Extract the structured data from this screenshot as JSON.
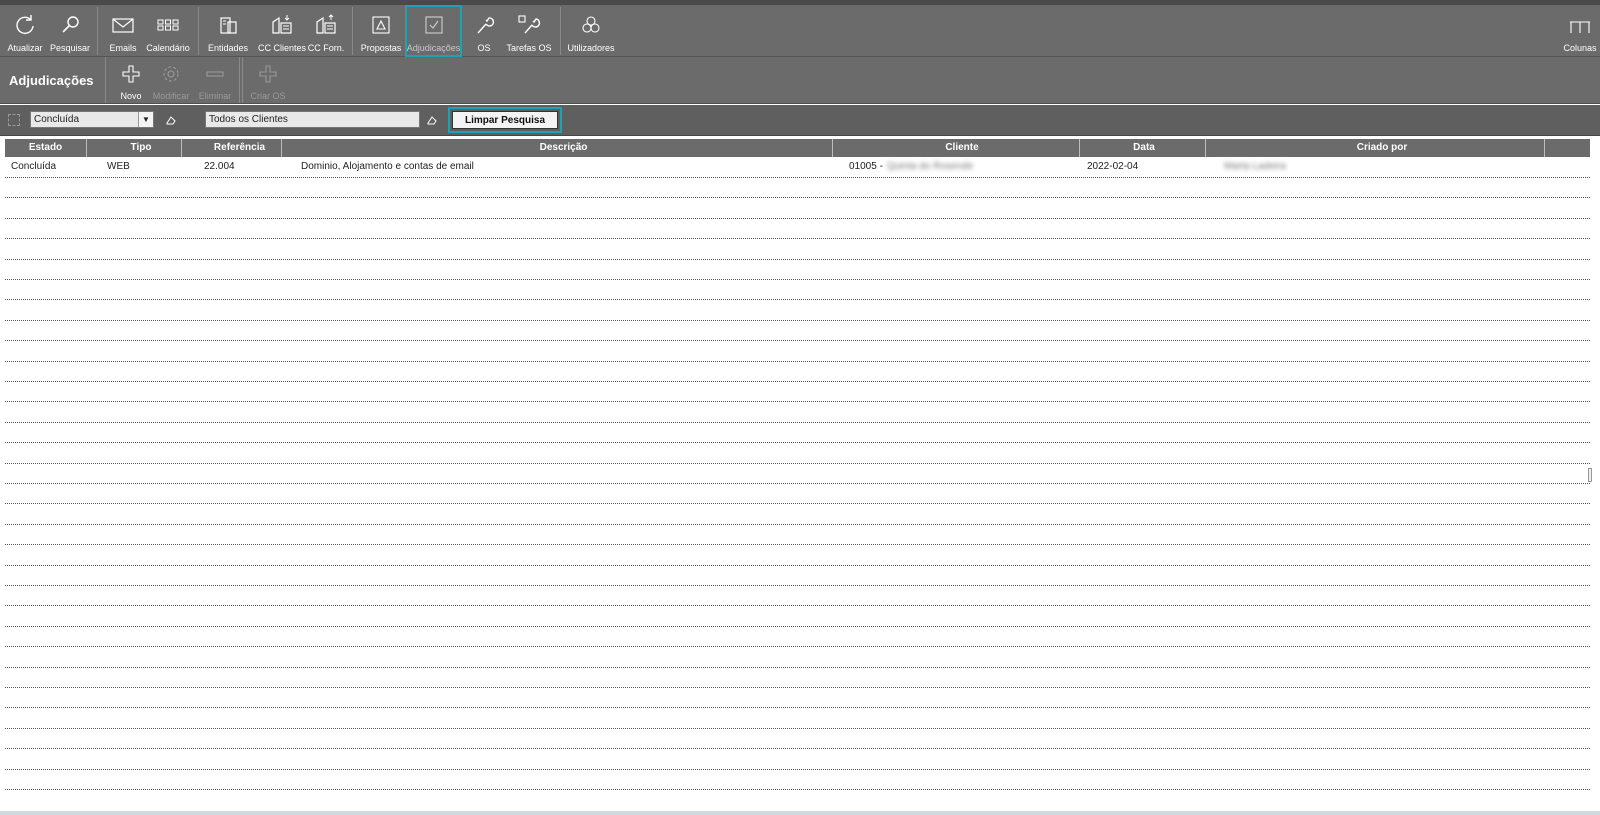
{
  "toolbar": {
    "items": [
      {
        "label": "Atualizar",
        "icon": "refresh-icon"
      },
      {
        "label": "Pesquisar",
        "icon": "search-icon"
      },
      {
        "label": "Emails",
        "icon": "mail-icon"
      },
      {
        "label": "Calendário",
        "icon": "calendar-icon"
      },
      {
        "label": "Entidades",
        "icon": "entities-icon"
      },
      {
        "label": "CC Clientes",
        "icon": "client-accounts-icon"
      },
      {
        "label": "CC Forn.",
        "icon": "supplier-accounts-icon"
      },
      {
        "label": "Propostas",
        "icon": "proposals-icon"
      },
      {
        "label": "Adjudicações",
        "icon": "check-icon"
      },
      {
        "label": "OS",
        "icon": "wrench-icon"
      },
      {
        "label": "Tarefas OS",
        "icon": "tasks-wrench-icon"
      },
      {
        "label": "Utilizadores",
        "icon": "users-icon"
      },
      {
        "label": "Colunas",
        "icon": "columns-icon"
      }
    ]
  },
  "section": {
    "title": "Adjudicações",
    "actions": [
      {
        "label": "Novo",
        "icon": "plus-icon"
      },
      {
        "label": "Modificar",
        "icon": "gear-icon"
      },
      {
        "label": "Eliminar",
        "icon": "minus-icon"
      },
      {
        "label": "Criar OS",
        "icon": "plus-icon"
      }
    ]
  },
  "filter": {
    "status_value": "Concluída",
    "client_value": "Todos os Clientes",
    "clear_label": "Limpar Pesquisa"
  },
  "table": {
    "headers": [
      "Estado",
      "Tipo",
      "Referência",
      "Descrição",
      "Cliente",
      "Data",
      "Criado por"
    ],
    "rows": [
      {
        "estado": "Concluída",
        "tipo": "WEB",
        "referencia": "22.004",
        "descricao": "Dominio,  Alojamento e contas de email",
        "cliente_code": "01005 -",
        "cliente_name": "Quinta do Rosende",
        "data": "2022-02-04",
        "criado_por": "Marta Ladeira"
      }
    ]
  },
  "colors": {
    "toolbar_bg": "#6b6b6b",
    "highlight": "#1aa3b5",
    "filter_bg": "#5f5f5f"
  }
}
